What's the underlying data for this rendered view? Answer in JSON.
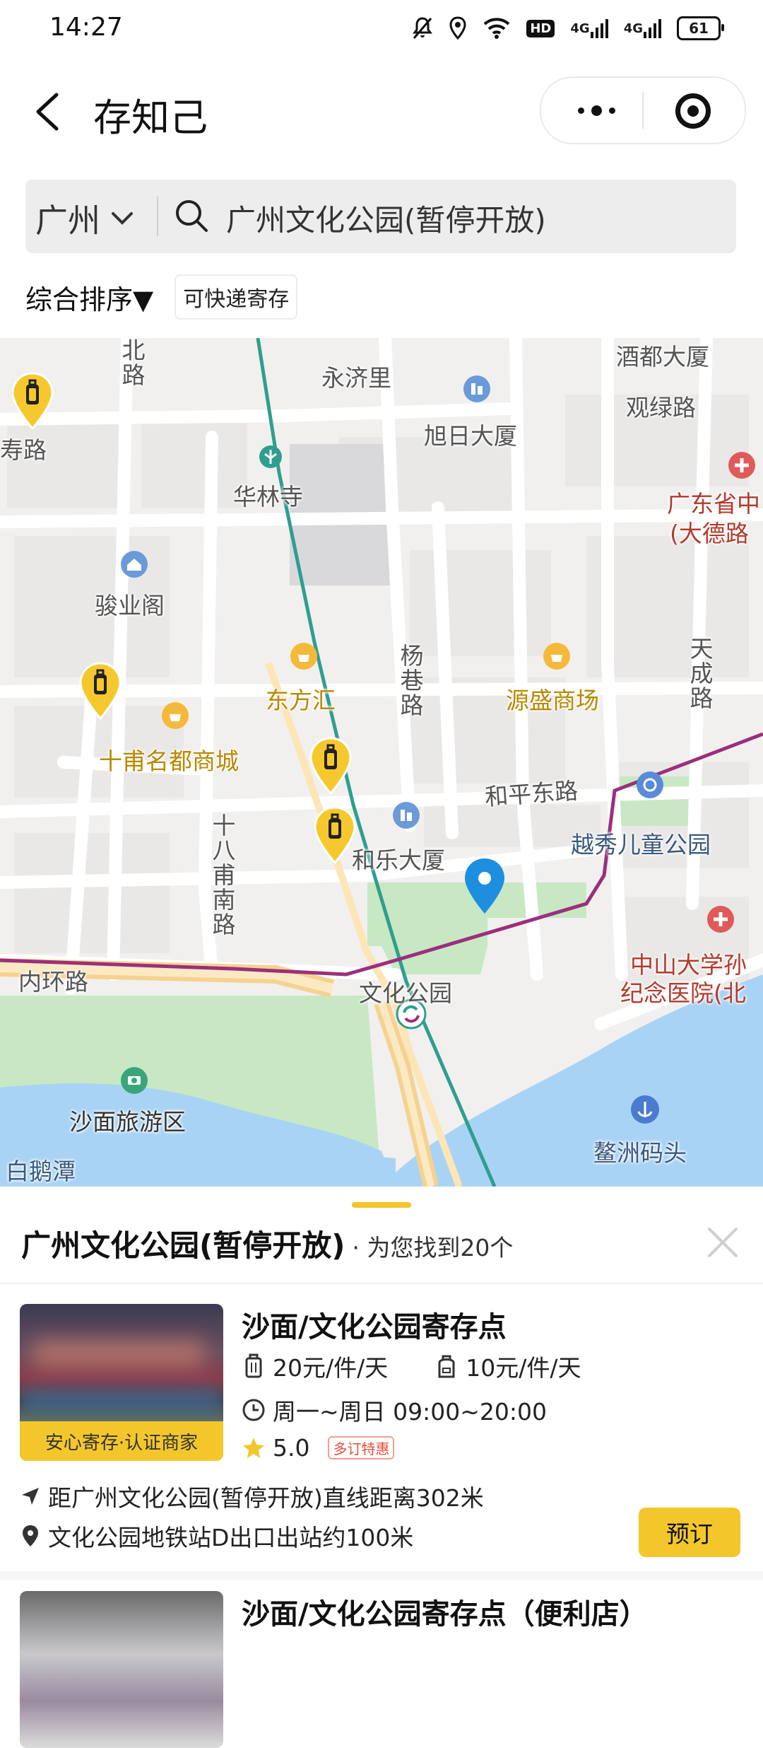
{
  "status_bar": {
    "time": "14:27",
    "battery": "61",
    "hd": "HD",
    "net1": "4G",
    "net2": "4G"
  },
  "header": {
    "title": "存知己"
  },
  "search": {
    "city": "广州",
    "query": "广州文化公园(暂停开放)"
  },
  "filters": {
    "sort_label": "综合排序▼",
    "chip_label": "可快递寄存"
  },
  "map": {
    "labels": {
      "bei_lu": "北路",
      "yongjili": "永济里",
      "jiudu": "酒都大厦",
      "guanlu": "观绿路",
      "xuri": "旭日大厦",
      "hualinsi": "华林寺",
      "gd_hosp": "广东省中",
      "dade": "(大德路",
      "junye": "骏业阁",
      "dongfanghui": "东方汇",
      "yangxiang": "杨巷路",
      "yuansheng": "源盛商场",
      "tiancheng": "天成路",
      "shifu": "十甫名都商城",
      "shibafu": "十八甫南路",
      "heping": "和平东路",
      "yuexiu_park": "越秀儿童公园",
      "hele": "和乐大厦",
      "zhongshan1": "中山大学孙",
      "zhongshan2": "纪念医院(北",
      "neihuan": "内环路",
      "wenhua": "文化公园",
      "shamian": "沙面旅游区",
      "aozhou": "鳌洲码头",
      "baietan": "白鹅潭",
      "shou_lu": "寿路"
    }
  },
  "results": {
    "location": "广州文化公园(暂停开放)",
    "count_text": "· 为您找到20个",
    "items": [
      {
        "title": "沙面/文化公园寄存点",
        "price_large": "20元/件/天",
        "price_small": "10元/件/天",
        "hours": "周一~周日 09:00~20:00",
        "rating": "5.0",
        "tag": "多订特惠",
        "badge": "安心寄存·认证商家",
        "distance": "距广州文化公园(暂停开放)直线距离302米",
        "address": "文化公园地铁站D出口出站约100米",
        "book_label": "预订"
      },
      {
        "title": "沙面/文化公园寄存点（便利店）"
      }
    ]
  },
  "colors": {
    "accent": "#f3c72c",
    "metro_green": "#2f9e8f",
    "metro_purple": "#9b2f7d",
    "river": "#a9d3f5",
    "park": "#c7e8c3"
  }
}
